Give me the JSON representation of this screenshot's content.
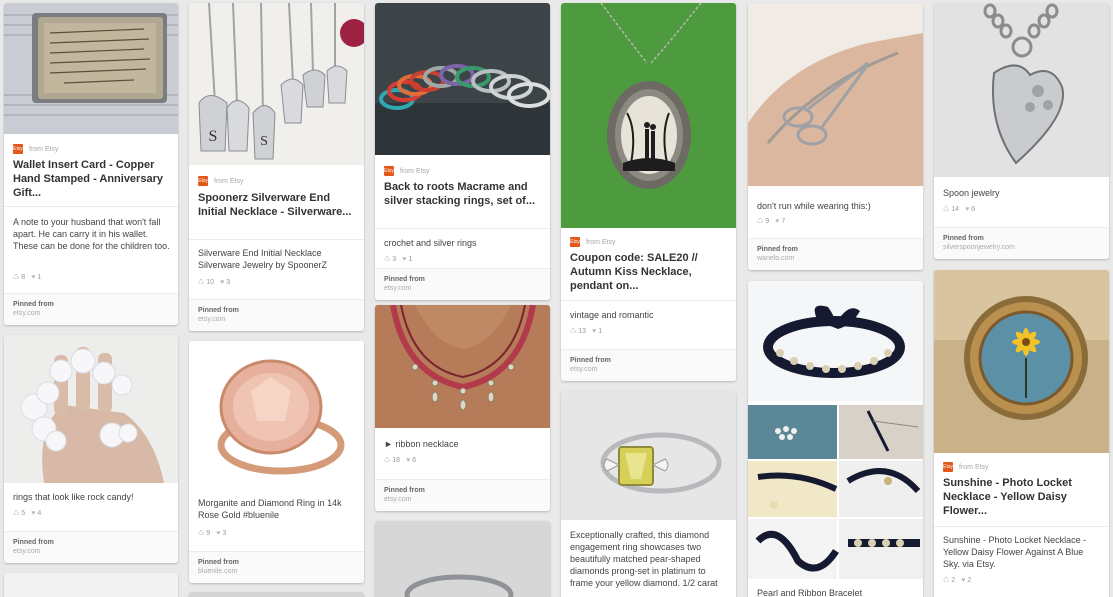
{
  "pins": {
    "wallet": {
      "title": "Wallet Insert Card - Copper Hand Stamped - Anniversary Gift...",
      "description": "A note to your husband that won't fall apart. He can carry it in his wallet. These can be done for the children too.",
      "repins": "8",
      "likes": "1",
      "pinned_label": "Pinned from",
      "source_domain": "etsy.com",
      "source_label": "from Etsy",
      "image_alt": "copper wallet insert card"
    },
    "spoon_initial": {
      "title": "Spoonerz Silverware End Initial Necklace - Silverware...",
      "description": "Silverware End Initial Necklace Silverware Jewelry by SpoonerZ",
      "repins": "10",
      "likes": "3",
      "pinned_label": "Pinned from",
      "source_domain": "etsy.com",
      "source_label": "from Etsy",
      "image_letters": [
        "S",
        "S"
      ]
    },
    "macrame": {
      "title": "Back to roots Macrame and silver stacking rings, set of...",
      "description": "crochet and silver rings",
      "repins": "3",
      "likes": "1",
      "pinned_label": "Pinned from",
      "source_domain": "etsy.com",
      "source_label": "from Etsy"
    },
    "coupon": {
      "title": "Coupon code: SALE20 // Autumn Kiss Necklace, pendant on...",
      "description": "vintage and romantic",
      "repins": "13",
      "likes": "1",
      "pinned_label": "Pinned from",
      "source_domain": "etsy.com",
      "source_label": "from Etsy"
    },
    "scissors": {
      "description": "don't run while wearing this:)",
      "repins": "9",
      "likes": "7",
      "pinned_label": "Pinned from",
      "source_domain": "wanelo.com"
    },
    "spoon_jewelry": {
      "description": "Spoon jewelry",
      "repins": "14",
      "likes": "6",
      "pinned_label": "Pinned from",
      "source_domain": "silverspoonjewelry.com"
    },
    "rock_candy": {
      "description": "rings that look like rock candy!",
      "repins": "5",
      "likes": "4",
      "pinned_label": "Pinned from",
      "source_domain": "etsy.com"
    },
    "morganite": {
      "description": "Morganite and Diamond Ring in 14k Rose Gold #bluenile",
      "repins": "9",
      "likes": "3",
      "pinned_label": "Pinned from",
      "source_domain": "bluenile.com"
    },
    "ribbon": {
      "description": "► ribbon necklace",
      "repins": "18",
      "likes": "6",
      "pinned_label": "Pinned from",
      "source_domain": "etsy.com"
    },
    "diamond": {
      "description": "Exceptionally crafted, this diamond engagement ring showcases two beautifully matched pear-shaped diamonds prong-set in platinum to frame your yellow diamond. 1/2 carat"
    },
    "pearl_ribbon": {
      "description": "Pearl and Ribbon Bracelet"
    },
    "locket": {
      "title": "Sunshine - Photo Locket Necklace - Yellow Daisy Flower...",
      "description": "Sunshine - Photo Locket Necklace - Yellow Daisy Flower Against A Blue Sky. via Etsy.",
      "repins": "2",
      "likes": "2",
      "source_label": "from Etsy"
    }
  },
  "icons": {
    "etsy": "etsy-logo-icon",
    "repin": "repin-icon",
    "like": "heart-icon"
  },
  "colors": {
    "etsy": "#e2571a",
    "background": "#e9e9e9"
  }
}
